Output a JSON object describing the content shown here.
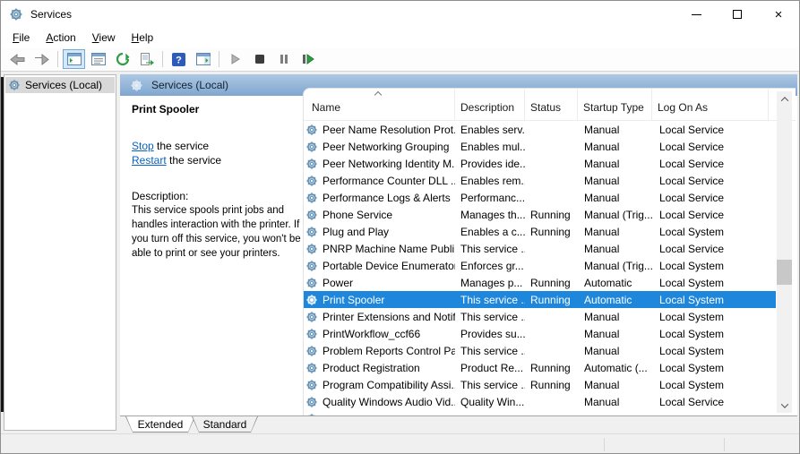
{
  "window": {
    "title": "Services"
  },
  "menu": {
    "items": [
      "File",
      "Action",
      "View",
      "Help"
    ]
  },
  "toolbar": {
    "icons": [
      "back",
      "forward",
      "show-console-tree",
      "properties",
      "refresh",
      "export-list",
      "help",
      "show-action-pane",
      "start-service",
      "stop-service",
      "pause-service",
      "restart-service"
    ]
  },
  "tree": {
    "root_label": "Services (Local)"
  },
  "band": {
    "title": "Services (Local)"
  },
  "info": {
    "title": "Print Spooler",
    "stop_link": "Stop",
    "stop_suffix": " the service",
    "restart_link": "Restart",
    "restart_suffix": " the service",
    "description_label": "Description:",
    "description": "This service spools print jobs and handles interaction with the printer. If you turn off this service, you won't be able to print or see your printers."
  },
  "table": {
    "columns": [
      "Name",
      "Description",
      "Status",
      "Startup Type",
      "Log On As"
    ],
    "sort_column": "Name",
    "sort_direction": "ascending",
    "rows": [
      {
        "name": "Peer Name Resolution Prot...",
        "description": "Enables serv...",
        "status": "",
        "startup": "Manual",
        "logon": "Local Service",
        "selected": false
      },
      {
        "name": "Peer Networking Grouping",
        "description": "Enables mul...",
        "status": "",
        "startup": "Manual",
        "logon": "Local Service",
        "selected": false
      },
      {
        "name": "Peer Networking Identity M...",
        "description": "Provides ide...",
        "status": "",
        "startup": "Manual",
        "logon": "Local Service",
        "selected": false
      },
      {
        "name": "Performance Counter DLL ...",
        "description": "Enables rem...",
        "status": "",
        "startup": "Manual",
        "logon": "Local Service",
        "selected": false
      },
      {
        "name": "Performance Logs & Alerts",
        "description": "Performanc...",
        "status": "",
        "startup": "Manual",
        "logon": "Local Service",
        "selected": false
      },
      {
        "name": "Phone Service",
        "description": "Manages th...",
        "status": "Running",
        "startup": "Manual (Trig...",
        "logon": "Local Service",
        "selected": false
      },
      {
        "name": "Plug and Play",
        "description": "Enables a c...",
        "status": "Running",
        "startup": "Manual",
        "logon": "Local System",
        "selected": false
      },
      {
        "name": "PNRP Machine Name Publi...",
        "description": "This service ...",
        "status": "",
        "startup": "Manual",
        "logon": "Local Service",
        "selected": false
      },
      {
        "name": "Portable Device Enumerator...",
        "description": "Enforces gr...",
        "status": "",
        "startup": "Manual (Trig...",
        "logon": "Local System",
        "selected": false
      },
      {
        "name": "Power",
        "description": "Manages p...",
        "status": "Running",
        "startup": "Automatic",
        "logon": "Local System",
        "selected": false
      },
      {
        "name": "Print Spooler",
        "description": "This service ...",
        "status": "Running",
        "startup": "Automatic",
        "logon": "Local System",
        "selected": true
      },
      {
        "name": "Printer Extensions and Notif...",
        "description": "This service ...",
        "status": "",
        "startup": "Manual",
        "logon": "Local System",
        "selected": false
      },
      {
        "name": "PrintWorkflow_ccf66",
        "description": "Provides su...",
        "status": "",
        "startup": "Manual",
        "logon": "Local System",
        "selected": false
      },
      {
        "name": "Problem Reports Control Pa...",
        "description": "This service ...",
        "status": "",
        "startup": "Manual",
        "logon": "Local System",
        "selected": false
      },
      {
        "name": "Product Registration",
        "description": "Product Re...",
        "status": "Running",
        "startup": "Automatic (...",
        "logon": "Local System",
        "selected": false
      },
      {
        "name": "Program Compatibility Assi...",
        "description": "This service ...",
        "status": "Running",
        "startup": "Manual",
        "logon": "Local System",
        "selected": false
      },
      {
        "name": "Quality Windows Audio Vid...",
        "description": "Quality Win...",
        "status": "",
        "startup": "Manual",
        "logon": "Local Service",
        "selected": false
      },
      {
        "name": "",
        "description": "",
        "status": "",
        "startup": "",
        "logon": "",
        "selected": false
      }
    ]
  },
  "tabs": [
    {
      "label": "Extended",
      "active": true
    },
    {
      "label": "Standard",
      "active": false
    }
  ],
  "colors": {
    "selection": "#1e87dc",
    "band_top": "#adc8e4",
    "band_bottom": "#7fa6cf",
    "link": "#0563c1",
    "toolbar_active_bg": "#d5e8f8",
    "toolbar_active_border": "#70a8d6"
  }
}
